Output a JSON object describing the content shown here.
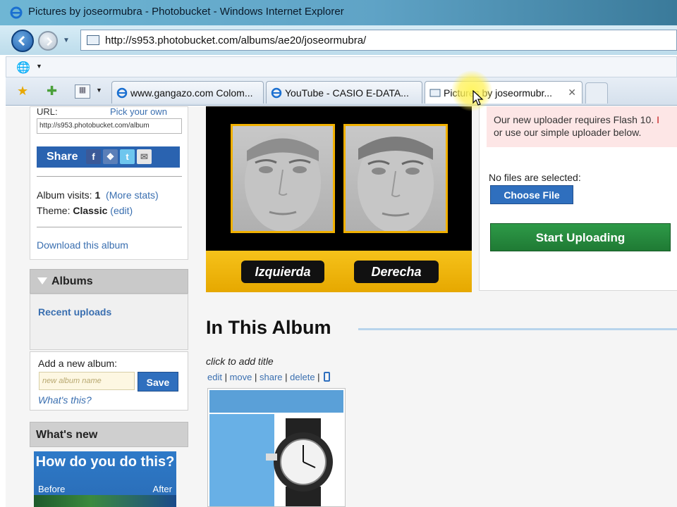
{
  "window": {
    "title": "Pictures by joseormubra - Photobucket - Windows Internet Explorer",
    "address": "http://s953.photobucket.com/albums/ae20/joseormubra/"
  },
  "tabs": [
    {
      "label": "www.gangazo.com Colom...",
      "active": false
    },
    {
      "label": "YouTube - CASIO E-DATA...",
      "active": false
    },
    {
      "label": "Pictures by joseormubr...",
      "active": true
    }
  ],
  "sidebar": {
    "url_label": "URL:",
    "pick_own": "Pick your own",
    "url_value": "http://s953.photobucket.com/album",
    "share_label": "Share",
    "share_icons": [
      "facebook-icon",
      "myspace-icon",
      "twitter-icon",
      "email-icon"
    ],
    "album_visits_label": "Album visits:",
    "album_visits_value": "1",
    "more_stats": "(More stats)",
    "theme_label": "Theme:",
    "theme_value": "Classic",
    "theme_edit": "(edit)",
    "download": "Download this album",
    "albums_heading": "Albums",
    "recent_uploads": "Recent uploads",
    "add_album_label": "Add a new album:",
    "album_placeholder": "new album name",
    "save": "Save",
    "whats_this": "What's this?",
    "whats_new": "What's new",
    "promo_question": "How do you do this?",
    "promo_before": "Before",
    "promo_after": "After"
  },
  "banner": {
    "left_button": "Izquierda",
    "right_button": "Derecha"
  },
  "uploader": {
    "message_line1": "Our new uploader requires Flash 10.",
    "message_link": "I",
    "message_line2": "or use our simple uploader below.",
    "no_files": "No files are selected:",
    "choose_file": "Choose File",
    "start_uploading": "Start Uploading"
  },
  "album": {
    "heading": "In This Album",
    "click_to_add_title": "click to add title",
    "actions": [
      "edit",
      "move",
      "share",
      "delete"
    ]
  },
  "colors": {
    "link": "#3a6fb0",
    "share_bar": "#2a63b0",
    "start_button": "#1f7a34",
    "banner_gold": "#f0b000"
  }
}
